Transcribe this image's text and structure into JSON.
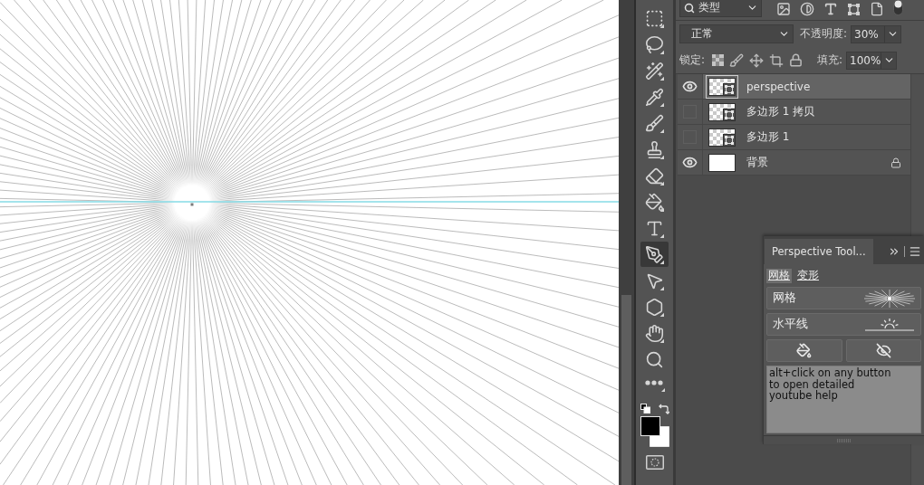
{
  "tools": [
    {
      "kind": "marquee",
      "selected": false
    },
    {
      "kind": "lasso",
      "selected": false
    },
    {
      "kind": "wand",
      "selected": false
    },
    {
      "kind": "eyedropper",
      "selected": false
    },
    {
      "kind": "brush",
      "selected": false
    },
    {
      "kind": "stamp",
      "selected": false
    },
    {
      "kind": "eraser",
      "selected": false
    },
    {
      "kind": "bucket",
      "selected": false
    },
    {
      "kind": "type",
      "selected": false
    },
    {
      "kind": "pen",
      "selected": true
    },
    {
      "kind": "select",
      "selected": false
    },
    {
      "kind": "shape",
      "selected": false
    },
    {
      "kind": "hand",
      "selected": false
    },
    {
      "kind": "zoom",
      "selected": false
    },
    {
      "kind": "more",
      "selected": false
    }
  ],
  "layers_panel": {
    "filter": "类型",
    "blend_mode": "正常",
    "opacity": {
      "label": "不透明度:",
      "value": "30%"
    },
    "lock_label": "锁定:",
    "fill": {
      "label": "填充:",
      "value": "100%"
    },
    "layers": [
      {
        "name": "perspective",
        "kind": "shape",
        "visible": true,
        "selected": true,
        "locked": false
      },
      {
        "name": "多边形 1 拷贝",
        "kind": "shape",
        "visible": false,
        "selected": false,
        "locked": false
      },
      {
        "name": "多边形 1",
        "kind": "shape",
        "visible": false,
        "selected": false,
        "locked": false
      },
      {
        "name": "背景",
        "kind": "fill",
        "visible": true,
        "selected": false,
        "locked": true
      }
    ]
  },
  "perspective_panel": {
    "title": "Perspective Tool...",
    "tabs": [
      {
        "label": "网格",
        "selected": true
      },
      {
        "label": "变形",
        "selected": false
      }
    ],
    "buttons": [
      {
        "label": "网格",
        "kind": "grid"
      },
      {
        "label": "水平线",
        "kind": "horizon"
      }
    ],
    "icon_buttons": [
      {
        "kind": "fill"
      },
      {
        "kind": "hide"
      }
    ],
    "help": "alt+click on any button\nto open detailed\nyoutube help"
  }
}
